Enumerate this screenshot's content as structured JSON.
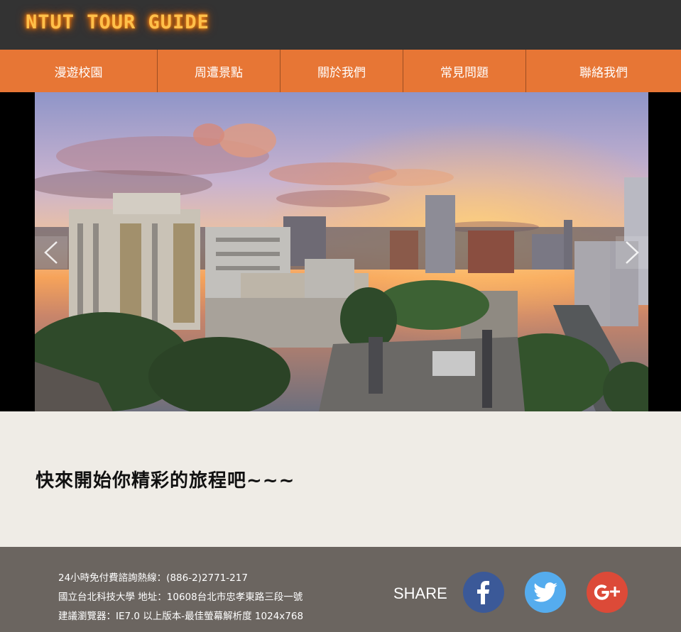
{
  "header": {
    "logo_text": "NTUT TOUR GUIDE"
  },
  "nav": {
    "items": [
      {
        "label": "漫遊校園"
      },
      {
        "label": "周遭景點"
      },
      {
        "label": "關於我們"
      },
      {
        "label": "常見問題"
      },
      {
        "label": "聯絡我們"
      }
    ]
  },
  "slider": {
    "image_icon": "campus-sunset-photo",
    "prev_icon": "chevron-left-icon",
    "next_icon": "chevron-right-icon"
  },
  "main": {
    "headline": "快來開始你精彩的旅程吧~~~"
  },
  "footer": {
    "lines": [
      "24小時免付費諮詢熱線：(886-2)2771-217",
      "國立台北科技大學 地址：10608台北市忠孝東路三段一號",
      "建議瀏覽器：IE7.0 以上版本-最佳螢幕解析度 1024x768"
    ],
    "share_label": "SHARE",
    "social": [
      {
        "icon": "facebook-icon",
        "color": "#3b5998"
      },
      {
        "icon": "twitter-icon",
        "color": "#55acee"
      },
      {
        "icon": "google-plus-icon",
        "color": "#dc4a38"
      }
    ]
  },
  "colors": {
    "header_bg": "#333333",
    "nav_bg": "#e77635",
    "content_bg": "#efece6",
    "footer_bg": "#6b6560",
    "logo": "#ffc04a"
  }
}
